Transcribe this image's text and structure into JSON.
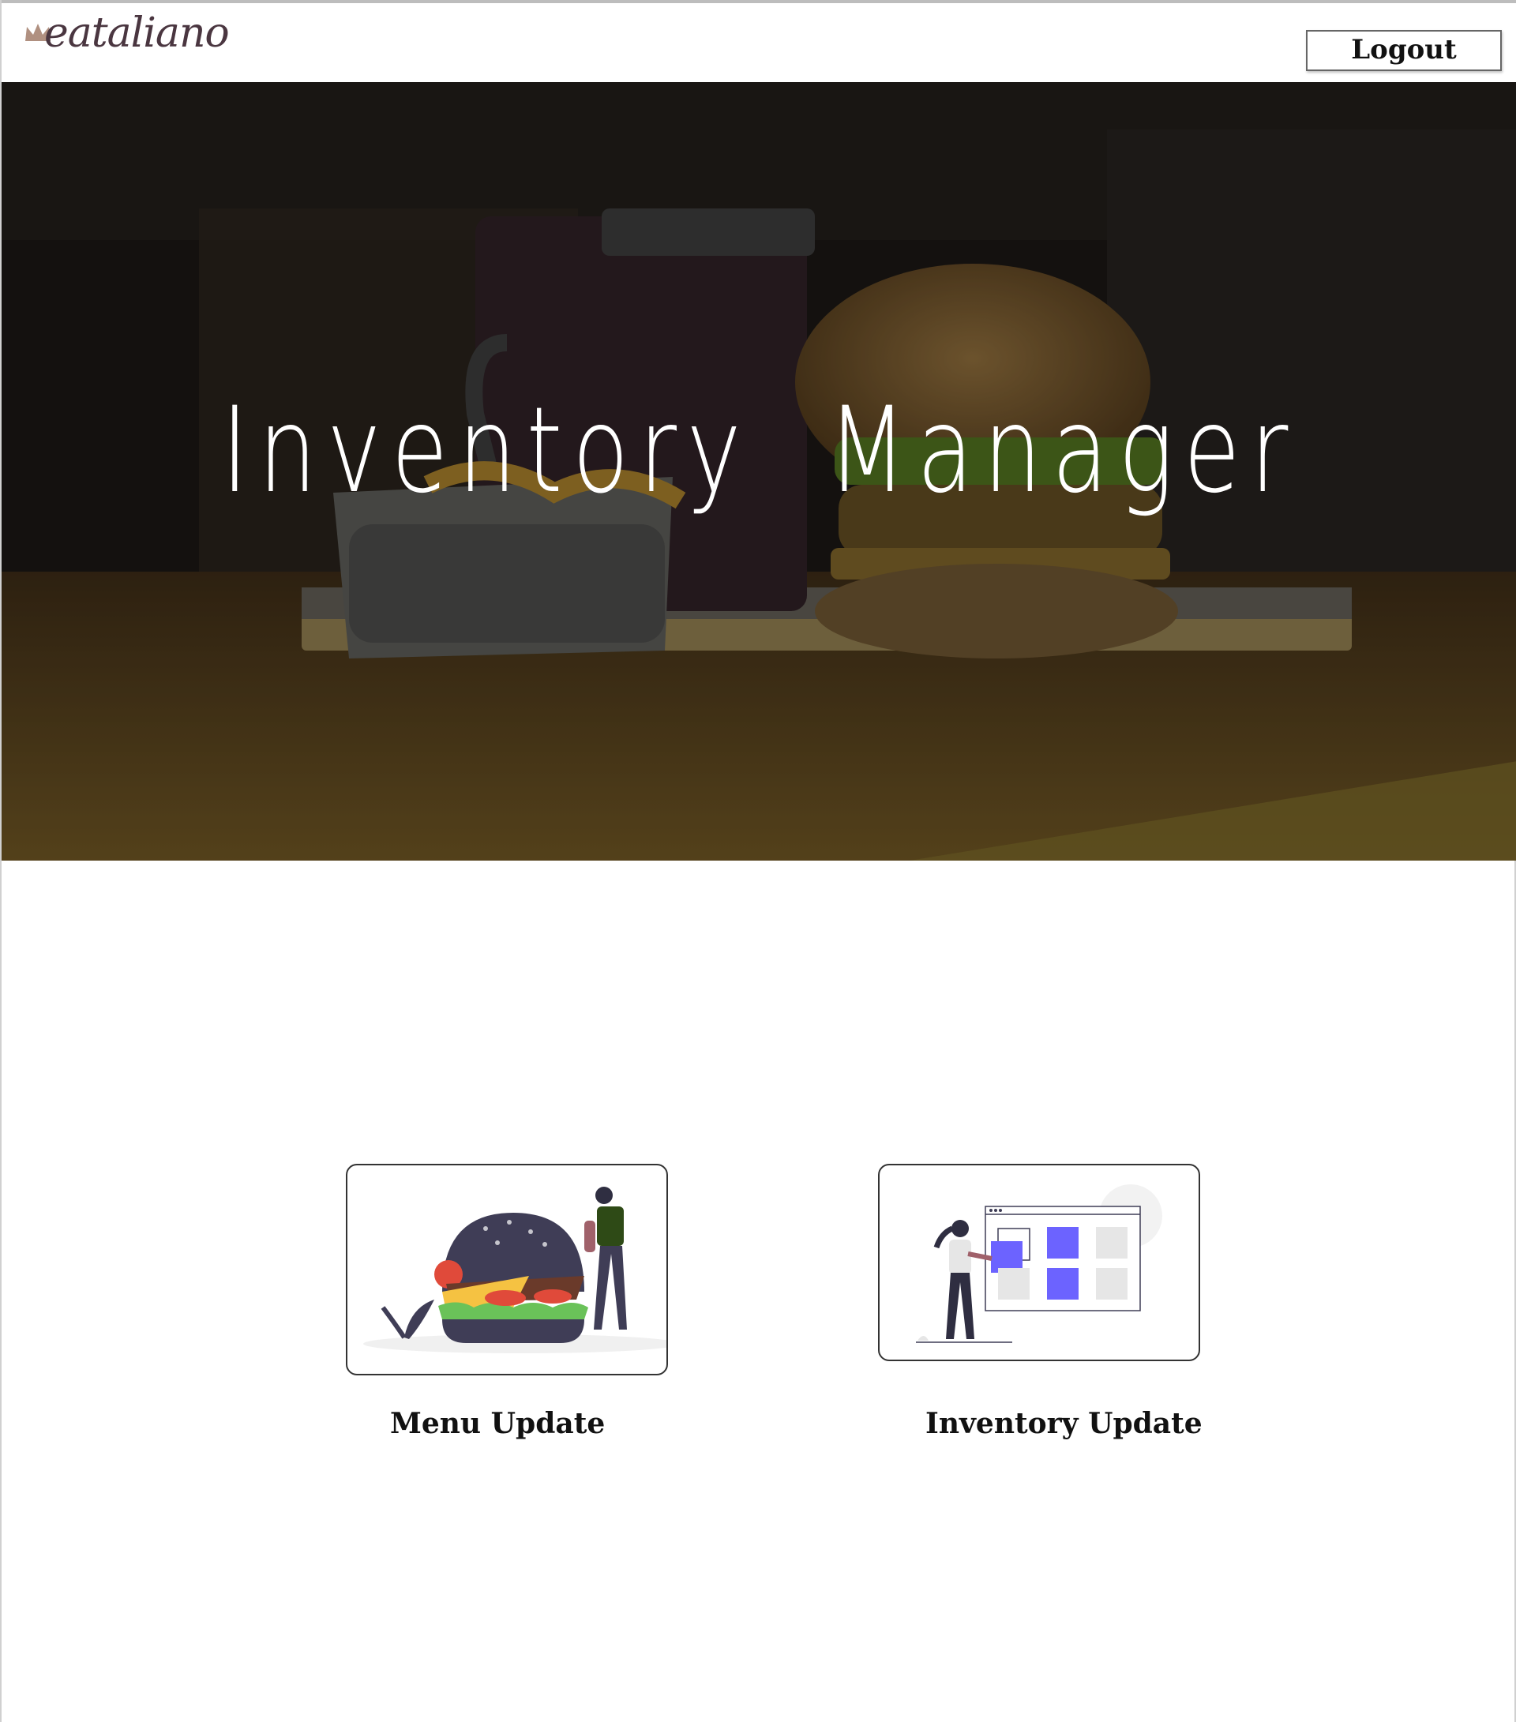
{
  "header": {
    "logo_text": "eataliano",
    "logout_label": "Logout"
  },
  "hero": {
    "title": "Inventory Manager"
  },
  "cards": [
    {
      "label": "Menu Update",
      "icon": "burger-illustration-icon"
    },
    {
      "label": "Inventory Update",
      "icon": "inventory-dashboard-illustration-icon"
    }
  ],
  "colors": {
    "accent_purple": "#6c63ff",
    "logo_text": "#4a3640",
    "hero_overlay": "#1d1915"
  }
}
